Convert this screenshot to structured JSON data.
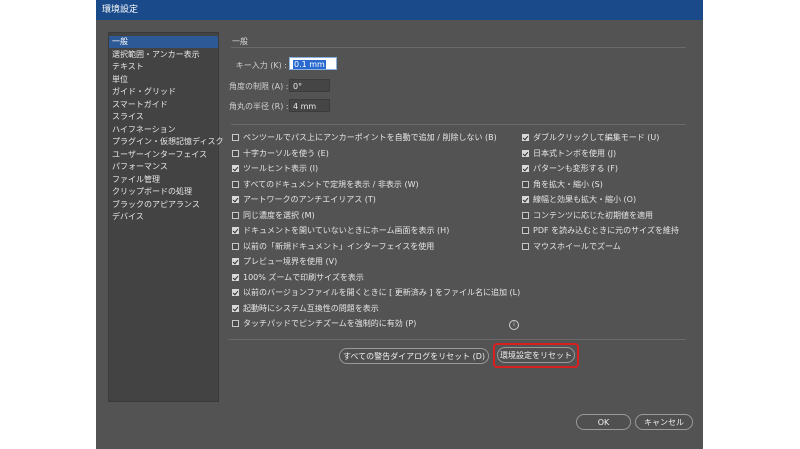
{
  "window": {
    "title": "環境設定"
  },
  "sidebar": {
    "items": [
      {
        "label": "一般",
        "selected": true
      },
      {
        "label": "選択範囲・アンカー表示",
        "selected": false
      },
      {
        "label": "テキスト",
        "selected": false
      },
      {
        "label": "単位",
        "selected": false
      },
      {
        "label": "ガイド・グリッド",
        "selected": false
      },
      {
        "label": "スマートガイド",
        "selected": false
      },
      {
        "label": "スライス",
        "selected": false
      },
      {
        "label": "ハイフネーション",
        "selected": false
      },
      {
        "label": "プラグイン・仮想記憶ディスク",
        "selected": false
      },
      {
        "label": "ユーザーインターフェイス",
        "selected": false
      },
      {
        "label": "パフォーマンス",
        "selected": false
      },
      {
        "label": "ファイル管理",
        "selected": false
      },
      {
        "label": "クリップボードの処理",
        "selected": false
      },
      {
        "label": "ブラックのアピアランス",
        "selected": false
      },
      {
        "label": "デバイス",
        "selected": false
      }
    ]
  },
  "section": {
    "title": "一般"
  },
  "fields": {
    "key_increment": {
      "label": "キー入力 (K) :",
      "value": "0.1 mm"
    },
    "constrain_angle": {
      "label": "角度の制限 (A) :",
      "value": "0°"
    },
    "corner_radius": {
      "label": "角丸の半径 (R) :",
      "value": "4 mm"
    }
  },
  "left_options": [
    {
      "label": "ペンツールでパス上にアンカーポイントを自動で追加 / 削除しない (B)",
      "checked": false
    },
    {
      "label": "十字カーソルを使う (E)",
      "checked": false
    },
    {
      "label": "ツールヒント表示 (I)",
      "checked": true
    },
    {
      "label": "すべてのドキュメントで定規を表示 / 非表示 (W)",
      "checked": false
    },
    {
      "label": "アートワークのアンチエイリアス (T)",
      "checked": true
    },
    {
      "label": "同じ濃度を選択 (M)",
      "checked": false
    },
    {
      "label": "ドキュメントを開いていないときにホーム画面を表示 (H)",
      "checked": true
    },
    {
      "label": "以前の「新規ドキュメント」インターフェイスを使用",
      "checked": false
    },
    {
      "label": "プレビュー境界を使用 (V)",
      "checked": true
    },
    {
      "label": "100% ズームで印刷サイズを表示",
      "checked": true
    },
    {
      "label": "以前のバージョンファイルを開くときに [ 更新済み ] をファイル名に追加 (L)",
      "checked": true
    },
    {
      "label": "起動時にシステム互換性の問題を表示",
      "checked": true
    },
    {
      "label": "タッチパッドでピンチズームを強制的に有効 (P)",
      "checked": false
    }
  ],
  "right_options": [
    {
      "label": "ダブルクリックして編集モード (U)",
      "checked": true
    },
    {
      "label": "日本式トンボを使用 (J)",
      "checked": true
    },
    {
      "label": "パターンも変形する (F)",
      "checked": true
    },
    {
      "label": "角を拡大・縮小 (S)",
      "checked": false
    },
    {
      "label": "線幅と効果も拡大・縮小 (O)",
      "checked": true
    },
    {
      "label": "コンテンツに応じた初期値を適用",
      "checked": false
    },
    {
      "label": "PDF を読み込むときに元のサイズを維持",
      "checked": false
    },
    {
      "label": "マウスホイールでズーム",
      "checked": false
    }
  ],
  "info_icon": {
    "name": "info-icon",
    "glyph": "i"
  },
  "buttons": {
    "reset_warnings": "すべての警告ダイアログをリセット (D)",
    "reset_preferences": "環境設定をリセット",
    "ok": "OK",
    "cancel": "キャンセル"
  },
  "colors": {
    "dialog_bg": "#535353",
    "titlebar": "#1a4a8a",
    "selection": "#2d5a96",
    "highlight": "#d92020"
  }
}
